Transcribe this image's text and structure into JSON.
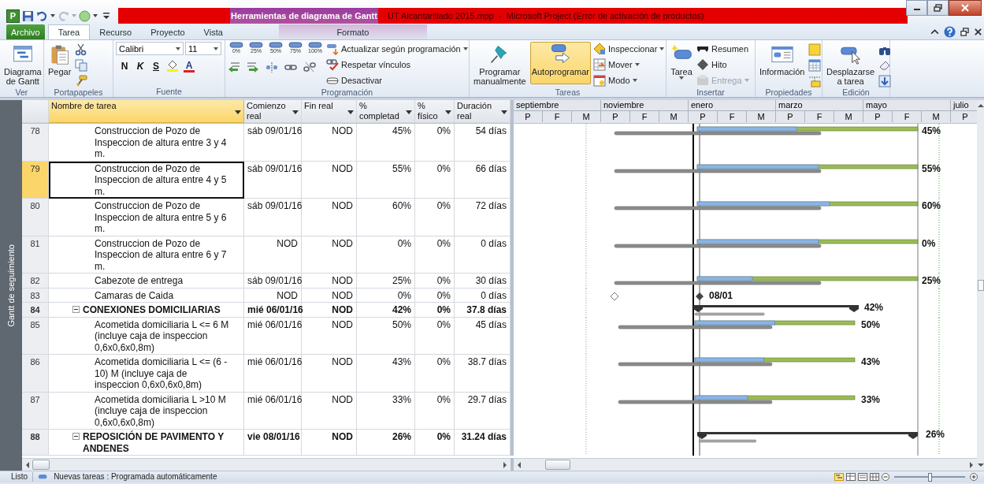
{
  "title_bar": {
    "app_letter": "P",
    "contextual_group": "Herramientas de diagrama de Gantt",
    "title": "UT Alcantarillado 2015.mpp  -  Microsoft Project (Error de activación de productos)"
  },
  "ribbon_tabs": [
    {
      "label": "Archivo",
      "kind": "file",
      "selected": false
    },
    {
      "label": "Tarea",
      "kind": "tab",
      "selected": true
    },
    {
      "label": "Recurso",
      "kind": "tab",
      "selected": false
    },
    {
      "label": "Proyecto",
      "kind": "tab",
      "selected": false
    },
    {
      "label": "Vista",
      "kind": "tab",
      "selected": false
    },
    {
      "label": "Formato",
      "kind": "contextual",
      "selected": false
    }
  ],
  "ribbon": {
    "view": {
      "label": "Ver",
      "gantt_chart": "Diagrama de Gantt"
    },
    "clipboard": {
      "label": "Portapapeles",
      "paste": "Pegar"
    },
    "font": {
      "label": "Fuente",
      "family": "Calibri",
      "size": "11",
      "bold": "N",
      "italic": "K",
      "underline": "S",
      "font_color": "A"
    },
    "schedule": {
      "label": "Programación",
      "percent_buttons": [
        "0%",
        "25%",
        "50%",
        "75%",
        "100%"
      ],
      "update": "Actualizar según programación",
      "respect_links": "Respetar vínculos",
      "inactivate": "Desactivar"
    },
    "tasks": {
      "label": "Tareas",
      "manual": "Programar manualmente",
      "auto": {
        "label": "Autoprogramar",
        "selected": true
      },
      "inspect": "Inspeccionar",
      "move": "Mover",
      "mode": "Modo"
    },
    "insert": {
      "label": "Insertar",
      "task": "Tarea",
      "summary": "Resumen",
      "milestone": "Hito",
      "deliverable": {
        "label": "Entrega",
        "disabled": true
      }
    },
    "properties": {
      "label": "Propiedades",
      "information": "Información"
    },
    "editing": {
      "label": "Edición",
      "scroll_to_task": "Desplazarse a tarea"
    }
  },
  "view_label": "Gantt de seguimiento",
  "table": {
    "columns": [
      {
        "label": "Nombre de tarea",
        "selected": true
      },
      {
        "label": "Comienzo real",
        "selected": false
      },
      {
        "label": "Fin real",
        "selected": false
      },
      {
        "label": "% completad",
        "selected": false
      },
      {
        "label": "% físico",
        "selected": false
      },
      {
        "label": "Duración real",
        "selected": false
      }
    ],
    "rows": [
      {
        "id": "78",
        "kind": "task",
        "selected": false,
        "name": "Construccion de Pozo de Inspeccion de altura entre 3 y 4 m.",
        "start": "sáb 09/01/16",
        "finish": "NOD",
        "complete": "45%",
        "physical": "0%",
        "duration": "54 días",
        "bar": {
          "level": 0.45,
          "label": "45%"
        }
      },
      {
        "id": "79",
        "kind": "task",
        "selected": true,
        "name": "Construccion de Pozo de Inspeccion de altura entre 4 y 5 m.",
        "start": "sáb 09/01/16",
        "finish": "NOD",
        "complete": "55%",
        "physical": "0%",
        "duration": "66 días",
        "bar": {
          "level": 0.55,
          "label": "55%"
        }
      },
      {
        "id": "80",
        "kind": "task",
        "selected": false,
        "name": "Construccion de Pozo de Inspeccion de altura entre 5 y 6 m.",
        "start": "sáb 09/01/16",
        "finish": "NOD",
        "complete": "60%",
        "physical": "0%",
        "duration": "72 días",
        "bar": {
          "level": 0.6,
          "label": "60%"
        }
      },
      {
        "id": "81",
        "kind": "task",
        "selected": false,
        "name": "Construccion de Pozo de Inspeccion de altura entre 6 y 7 m.",
        "start": "NOD",
        "finish": "NOD",
        "complete": "0%",
        "physical": "0%",
        "duration": "0 días",
        "bar": {
          "level": 0.55,
          "label": "0%"
        }
      },
      {
        "id": "82",
        "kind": "task",
        "selected": false,
        "name": "Cabezote de entrega",
        "start": "sáb 09/01/16",
        "finish": "NOD",
        "complete": "25%",
        "physical": "0%",
        "duration": "30 días",
        "bar": {
          "level": 0.25,
          "label": "25%"
        }
      },
      {
        "id": "83",
        "kind": "milestone",
        "selected": false,
        "name": "Camaras de Caida",
        "start": "NOD",
        "finish": "NOD",
        "complete": "0%",
        "physical": "0%",
        "duration": "0 días",
        "bar": {
          "label": "08/01"
        }
      },
      {
        "id": "84",
        "kind": "summary",
        "selected": false,
        "expanded": true,
        "name": "CONEXIONES DOMICILIARIAS",
        "start": "mié 06/01/16",
        "finish": "NOD",
        "complete": "42%",
        "physical": "0%",
        "duration": "37.8 días",
        "bar": {
          "level": 0.42,
          "label": "42%"
        }
      },
      {
        "id": "85",
        "kind": "task",
        "selected": false,
        "name": "Acometida domiciliaria L <= 6 M (incluye caja de inspeccion 0,6x0,6x0,8m)",
        "start": "mié 06/01/16",
        "finish": "NOD",
        "complete": "50%",
        "physical": "0%",
        "duration": "45 días",
        "bar": {
          "level": 0.5,
          "label": "50%"
        }
      },
      {
        "id": "86",
        "kind": "task",
        "selected": false,
        "name": "Acometida domiciliaria L <= (6 - 10) M (incluye caja de inspeccion 0,6x0,6x0,8m)",
        "start": "mié 06/01/16",
        "finish": "NOD",
        "complete": "43%",
        "physical": "0%",
        "duration": "38.7 días",
        "bar": {
          "level": 0.43,
          "label": "43%"
        }
      },
      {
        "id": "87",
        "kind": "task",
        "selected": false,
        "name": "Acometida domiciliaria L >10 M (incluye caja de inspeccion 0,6x0,6x0,8m)",
        "start": "mié 06/01/16",
        "finish": "NOD",
        "complete": "33%",
        "physical": "0%",
        "duration": "29.7 días",
        "bar": {
          "level": 0.33,
          "label": "33%"
        }
      },
      {
        "id": "88",
        "kind": "summary",
        "selected": false,
        "expanded": true,
        "name": "REPOSICIÓN DE PAVIMENTO Y ANDENES",
        "start": "vie 08/01/16",
        "finish": "NOD",
        "complete": "26%",
        "physical": "0%",
        "duration": "31.24 días",
        "bar": {
          "level": 0.26,
          "label": "26%"
        }
      }
    ]
  },
  "gantt": {
    "periods": [
      {
        "label": "septiembre",
        "units": [
          "P",
          "F",
          "M"
        ]
      },
      {
        "label": "noviembre",
        "units": [
          "P",
          "F",
          "M"
        ]
      },
      {
        "label": "enero",
        "units": [
          "P",
          "F",
          "M"
        ]
      },
      {
        "label": "marzo",
        "units": [
          "P",
          "F",
          "M"
        ]
      },
      {
        "label": "mayo",
        "units": [
          "P",
          "F",
          "M"
        ]
      },
      {
        "label": "julio",
        "units": [
          "P"
        ]
      }
    ]
  },
  "status_bar": {
    "ready": "Listo",
    "new_tasks": "Nuevas tareas : Programada automáticamente",
    "zoom": {
      "level": 0.5
    }
  }
}
